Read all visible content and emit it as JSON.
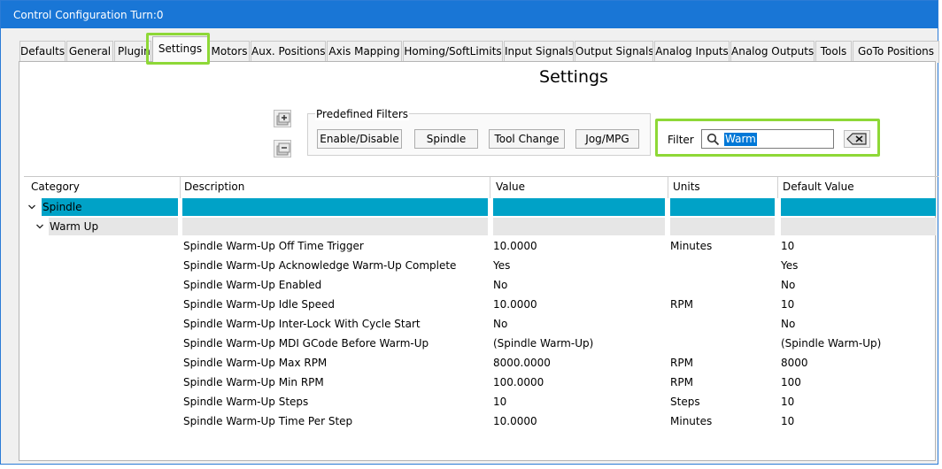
{
  "window": {
    "title": "Control Configuration Turn:0"
  },
  "tabs": [
    {
      "label": "Defaults",
      "active": false
    },
    {
      "label": "General",
      "active": false
    },
    {
      "label": "Plugins",
      "active": false
    },
    {
      "label": "Settings",
      "active": true
    },
    {
      "label": "Motors",
      "active": false
    },
    {
      "label": "Aux. Positions",
      "active": false
    },
    {
      "label": "Axis Mapping",
      "active": false
    },
    {
      "label": "Homing/SoftLimits",
      "active": false
    },
    {
      "label": "Input Signals",
      "active": false
    },
    {
      "label": "Output Signals",
      "active": false
    },
    {
      "label": "Analog Inputs",
      "active": false
    },
    {
      "label": "Analog Outputs",
      "active": false
    },
    {
      "label": "Tools",
      "active": false
    },
    {
      "label": "GoTo Positions",
      "active": false
    }
  ],
  "page": {
    "title": "Settings"
  },
  "toolbar": {
    "expand_icon": "expand-all-icon",
    "collapse_icon": "collapse-all-icon"
  },
  "predefined_filters": {
    "legend": "Predefined Filters",
    "buttons": [
      "Enable/Disable",
      "Spindle",
      "Tool Change",
      "Jog/MPG"
    ]
  },
  "filter": {
    "label": "Filter",
    "value": "Warm",
    "search_icon": "search-icon",
    "clear_icon": "clear-text-icon"
  },
  "grid": {
    "columns": [
      "Category",
      "Description",
      "Value",
      "Units",
      "Default Value"
    ],
    "category": "Spindle",
    "subcategory": "Warm Up",
    "rows": [
      {
        "description": "Spindle Warm-Up Off Time Trigger",
        "value": "10.0000",
        "units": "Minutes",
        "default": "10"
      },
      {
        "description": "Spindle Warm-Up Acknowledge Warm-Up Complete",
        "value": "Yes",
        "units": "",
        "default": "Yes"
      },
      {
        "description": "Spindle Warm-Up Enabled",
        "value": "No",
        "units": "",
        "default": "No"
      },
      {
        "description": "Spindle Warm-Up Idle Speed",
        "value": "10.0000",
        "units": "RPM",
        "default": "10"
      },
      {
        "description": "Spindle Warm-Up Inter-Lock With Cycle Start",
        "value": "No",
        "units": "",
        "default": "No"
      },
      {
        "description": "Spindle Warm-Up MDI GCode Before Warm-Up",
        "value": "(Spindle Warm-Up)",
        "units": "",
        "default": "(Spindle Warm-Up)"
      },
      {
        "description": "Spindle Warm-Up Max RPM",
        "value": "8000.0000",
        "units": "RPM",
        "default": "8000"
      },
      {
        "description": "Spindle Warm-Up Min RPM",
        "value": "100.0000",
        "units": "RPM",
        "default": "100"
      },
      {
        "description": "Spindle Warm-Up Steps",
        "value": "10",
        "units": "Steps",
        "default": "10"
      },
      {
        "description": "Spindle Warm-Up Time Per Step",
        "value": "10.0000",
        "units": "Minutes",
        "default": "10"
      }
    ]
  },
  "colors": {
    "titlebar": "#1976d6",
    "category_band": "#00a2c7",
    "subcategory_band": "#e6e6e6",
    "highlight": "#8ed837"
  }
}
